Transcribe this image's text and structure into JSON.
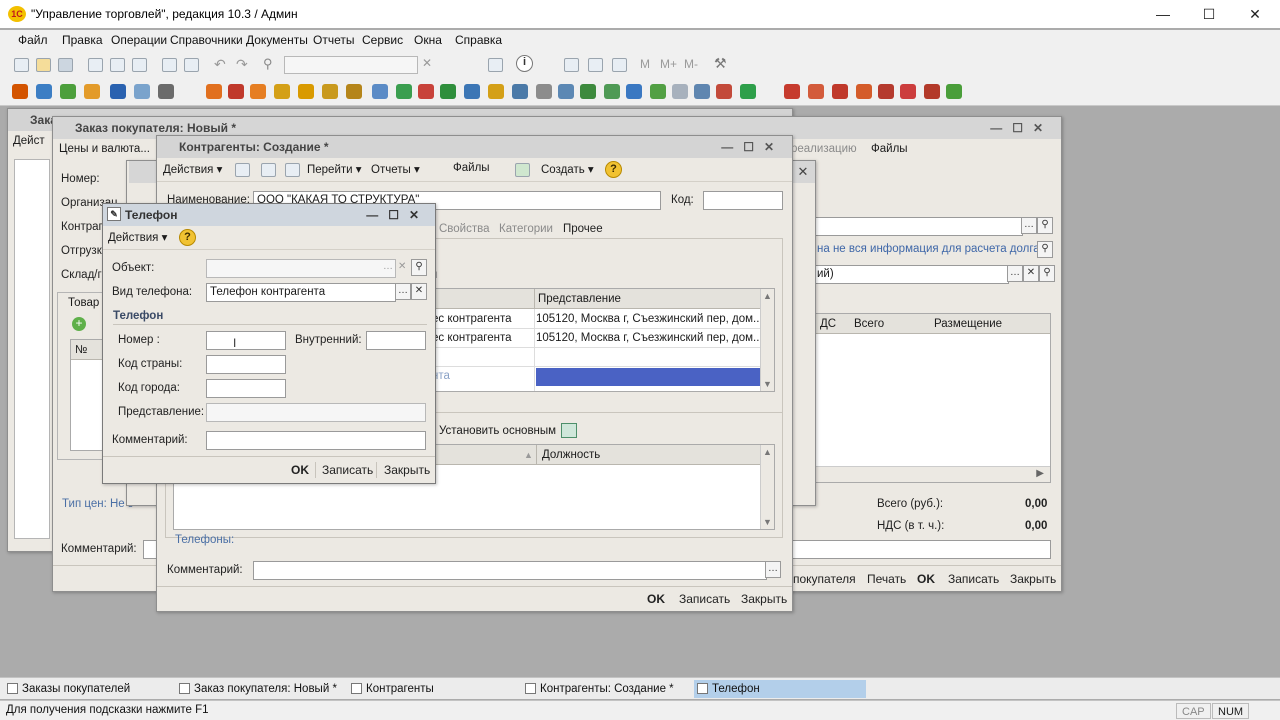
{
  "app": {
    "title": "\"Управление торговлей\", редакция 10.3 / Админ",
    "logo": "1С"
  },
  "window_controls": {
    "minimize": "—",
    "maximize": "☐",
    "close": "✕"
  },
  "menu": [
    "Файл",
    "Правка",
    "Операции",
    "Справочники",
    "Документы",
    "Отчеты",
    "Сервис",
    "Окна",
    "Справка"
  ],
  "toolbar": {
    "calc_m": "M",
    "calc_mplus": "M+",
    "calc_mminus": "M-"
  },
  "win_orders": {
    "title": "Зака",
    "action": "Дейст"
  },
  "win_order": {
    "title": "Заказ покупателя: Новый *",
    "tabs": [
      "Цены и валюта..."
    ],
    "labels": {
      "number": "Номер:",
      "org": "Организац",
      "contr": "Контраг",
      "shipment": "Отгрузк",
      "warehouse": "Склад/г"
    },
    "goods_tab": "Товар",
    "right_tabs": {
      "realization": "реализацию",
      "files": "Файлы"
    },
    "debt_warning": "на не вся информация для расчета долга.",
    "right_field": "ий)",
    "grid_cols": {
      "vat": "ДС",
      "total": "Всего",
      "placement": "Размещение"
    },
    "price_type": "Тип цен: Не з",
    "total_label": "Всего (руб.):",
    "total_value": "0,00",
    "vat_label": "НДС (в т. ч.):",
    "vat_value": "0,00",
    "comment_label": "Комментарий:",
    "footer": {
      "buyer": "покупателя",
      "print": "Печать",
      "ok": "OK",
      "save": "Записать",
      "close": "Закрыть"
    },
    "num_col": "№"
  },
  "win_contr": {
    "title": "Контрагенты: Создание *",
    "cmd": {
      "actions": "Действия",
      "goto": "Перейти",
      "reports": "Отчеты",
      "files": "Файлы",
      "create": "Создать"
    },
    "name_label": "Наименование:",
    "name_value": "ООО \"КАКАЯ ТО СТРУКТУРА\"",
    "code_label": "Код:",
    "tabs": [
      "Свойства",
      "Категории",
      "Прочее"
    ],
    "section_hint": "ия",
    "addr_grid": {
      "col_repr": "Представление",
      "rows": [
        {
          "type": "ес контрагента",
          "repr": "105120, Москва г, Съезжинский пер, дом..."
        },
        {
          "type": "ес контрагента",
          "repr": "105120, Москва г, Съезжинский пер, дом..."
        },
        {
          "type": "",
          "repr": ""
        },
        {
          "type": "нта",
          "repr": ""
        }
      ]
    },
    "set_main": "Установить основным",
    "contacts_col": "Должность",
    "phones_link": "Телефоны:",
    "comment_label": "Комментарий:",
    "footer": {
      "ok": "OK",
      "save": "Записать",
      "close": "Закрыть"
    }
  },
  "win_phone": {
    "title": "Телефон",
    "actions": "Действия",
    "object_label": "Объект:",
    "object_value": "",
    "phone_type_label": "Вид телефона:",
    "phone_type_value": "Телефон контрагента",
    "section": "Телефон",
    "number_label": "Номер :",
    "number_value": "",
    "internal_label": "Внутренний:",
    "internal_value": "",
    "country_label": "Код страны:",
    "country_value": "",
    "city_label": "Код города:",
    "city_value": "",
    "repr_label": "Представление:",
    "repr_value": "",
    "comment_label": "Комментарий:",
    "comment_value": "",
    "footer": {
      "ok": "OK",
      "save": "Записать",
      "close": "Закрыть"
    }
  },
  "taskbar": [
    "Заказы покупателей",
    "Заказ покупателя: Новый *",
    "Контрагенты",
    "Контрагенты: Создание *",
    "Телефон"
  ],
  "status": {
    "hint": "Для получения подсказки нажмите F1",
    "cap": "CAP",
    "num": "NUM"
  }
}
